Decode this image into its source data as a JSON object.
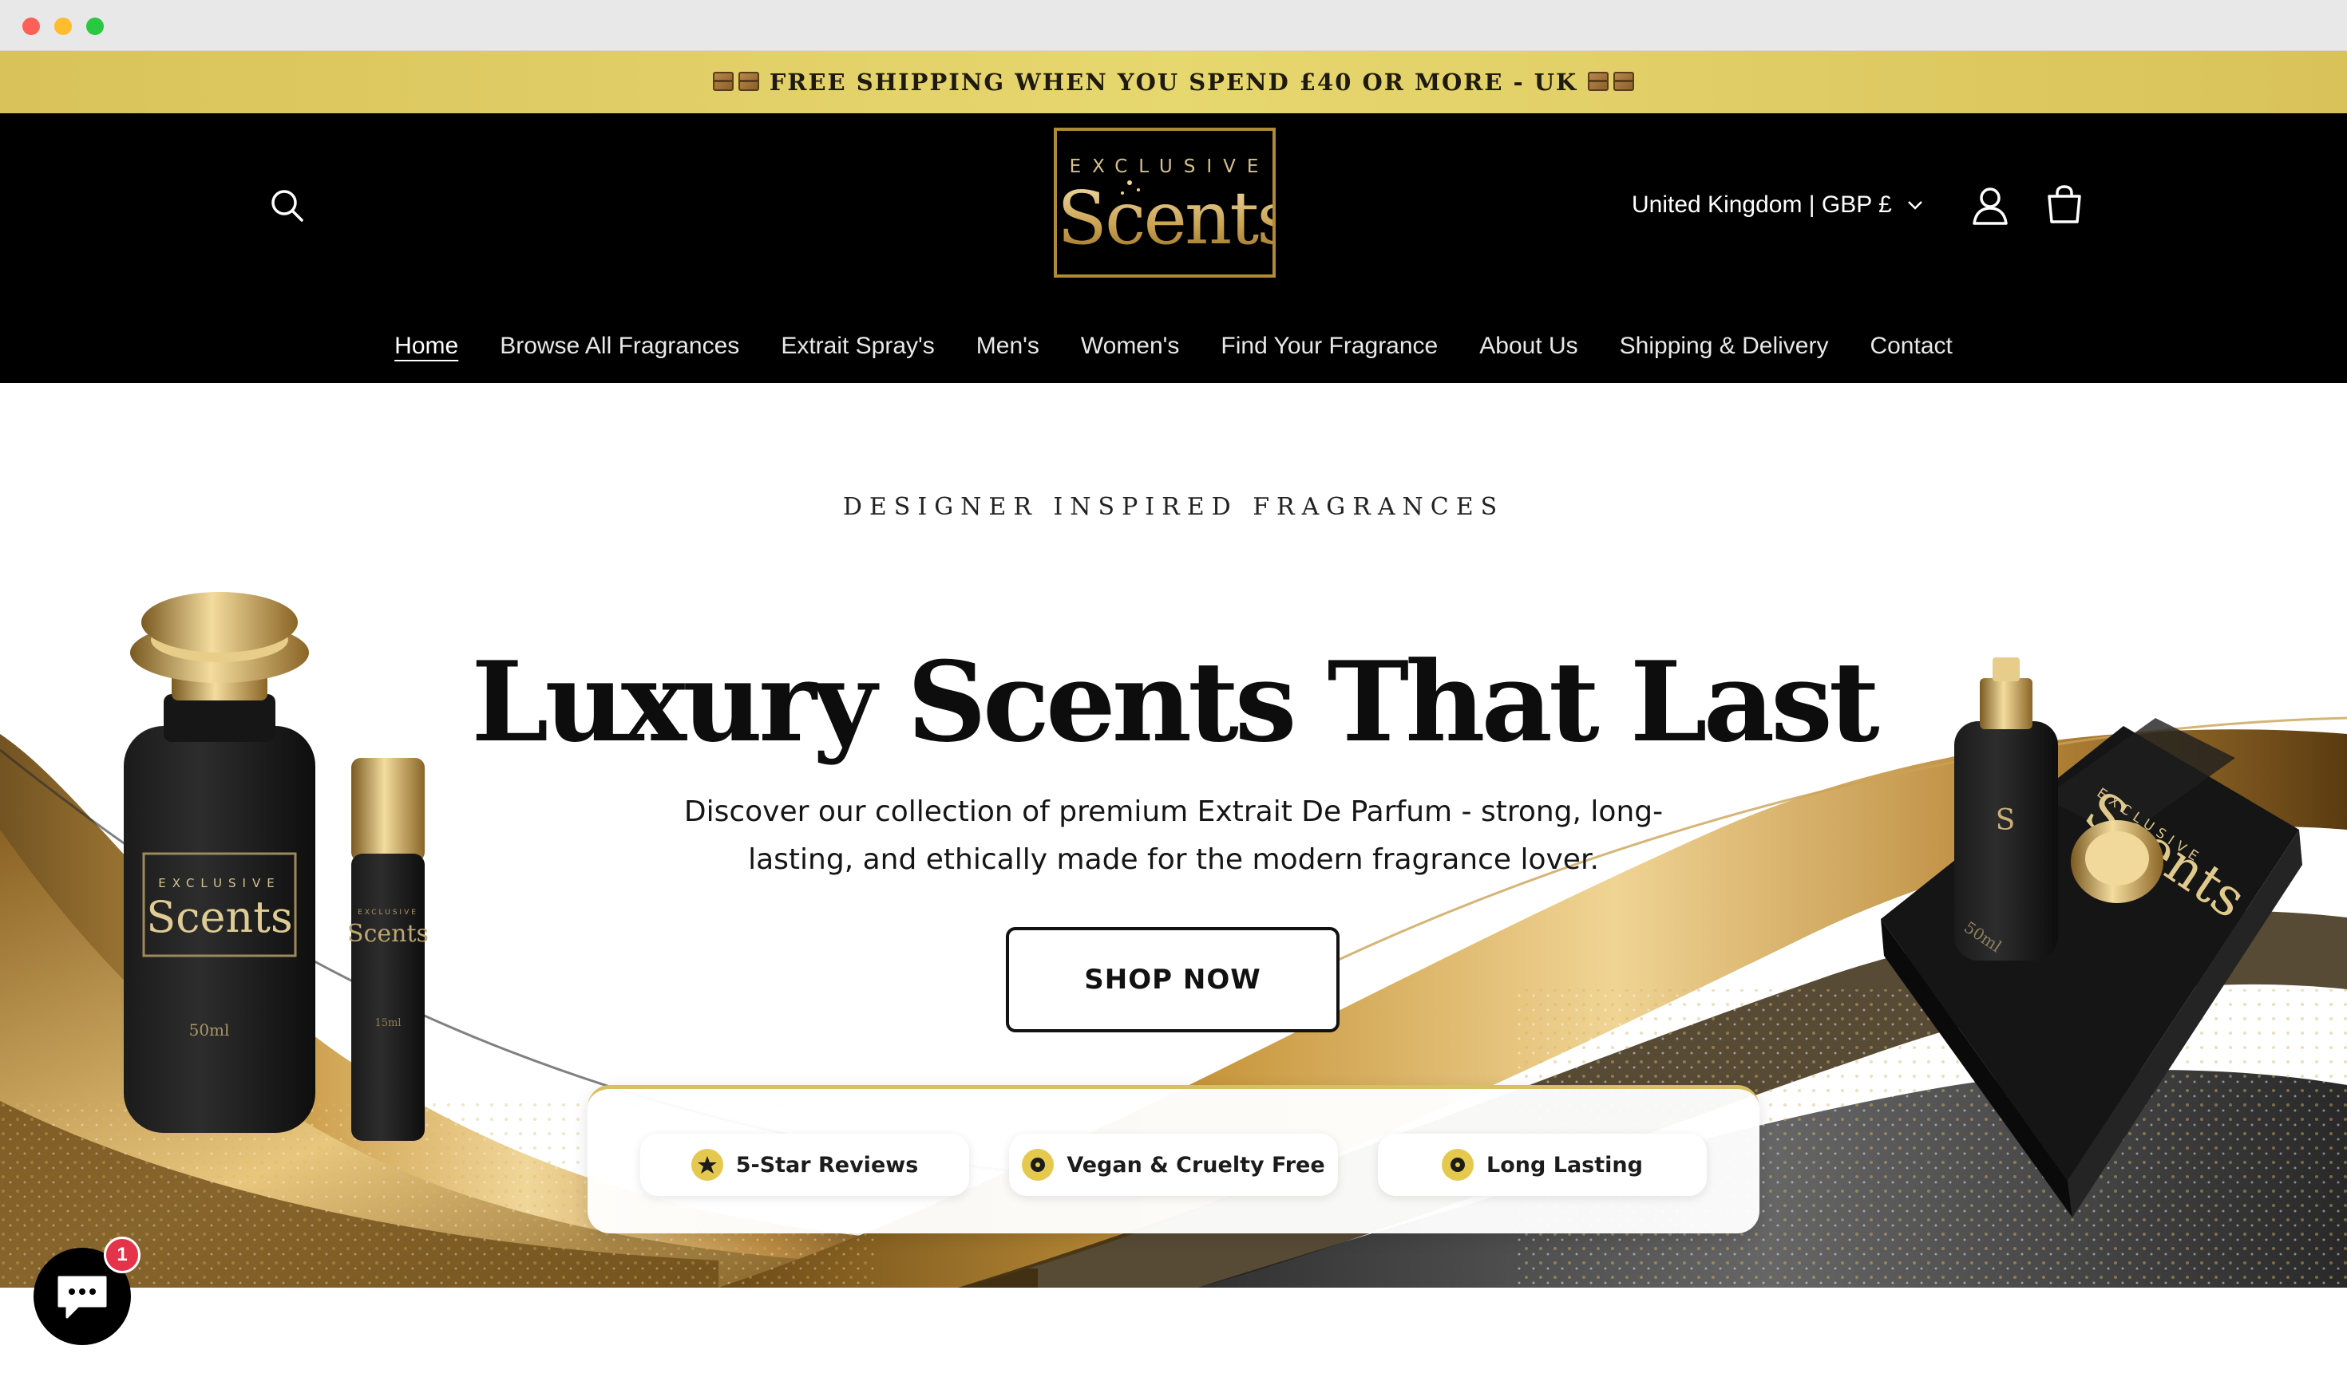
{
  "announcement": {
    "text": "FREE SHIPPING WHEN YOU SPEND £40 OR MORE - UK"
  },
  "header": {
    "logo": {
      "top": "EXCLUSIVE",
      "main": "Scents"
    },
    "region": "United Kingdom | GBP £",
    "icons": [
      "search-icon",
      "account-icon",
      "cart-icon",
      "chevron-down-icon"
    ]
  },
  "nav": {
    "items": [
      {
        "label": "Home",
        "active": true
      },
      {
        "label": "Browse All Fragrances"
      },
      {
        "label": "Extrait Spray's"
      },
      {
        "label": "Men's"
      },
      {
        "label": "Women's"
      },
      {
        "label": "Find Your Fragrance"
      },
      {
        "label": "About Us"
      },
      {
        "label": "Shipping & Delivery"
      },
      {
        "label": "Contact"
      }
    ]
  },
  "hero": {
    "eyebrow": "DESIGNER INSPIRED FRAGRANCES",
    "headline": "Luxury Scents That Last",
    "subtext": "Discover our collection of premium Extrait De Parfum - strong, long-lasting, and ethically made for the modern fragrance lover.",
    "cta": "SHOP NOW",
    "badges": [
      {
        "label": "5-Star Reviews",
        "icon": "star-icon"
      },
      {
        "label": "Vegan & Cruelty Free",
        "icon": "leaf-icon"
      },
      {
        "label": "Long Lasting",
        "icon": "clock-icon"
      }
    ],
    "product_labels": {
      "bottle_large": {
        "brand_top": "EXCLUSIVE",
        "brand": "Scents",
        "size": "50ml"
      },
      "bottle_small": {
        "brand_top": "EXCLUSIVE",
        "brand": "Scents",
        "size": "15ml"
      },
      "gift_box": {
        "brand_top": "EXCLUSIVE",
        "brand": "Scents",
        "size": "50ml"
      }
    }
  },
  "chat": {
    "unread": "1"
  },
  "colors": {
    "gold": "#d9bf63",
    "black": "#000000",
    "announce": "#e2cf68",
    "badge_alert": "#e5334a"
  }
}
